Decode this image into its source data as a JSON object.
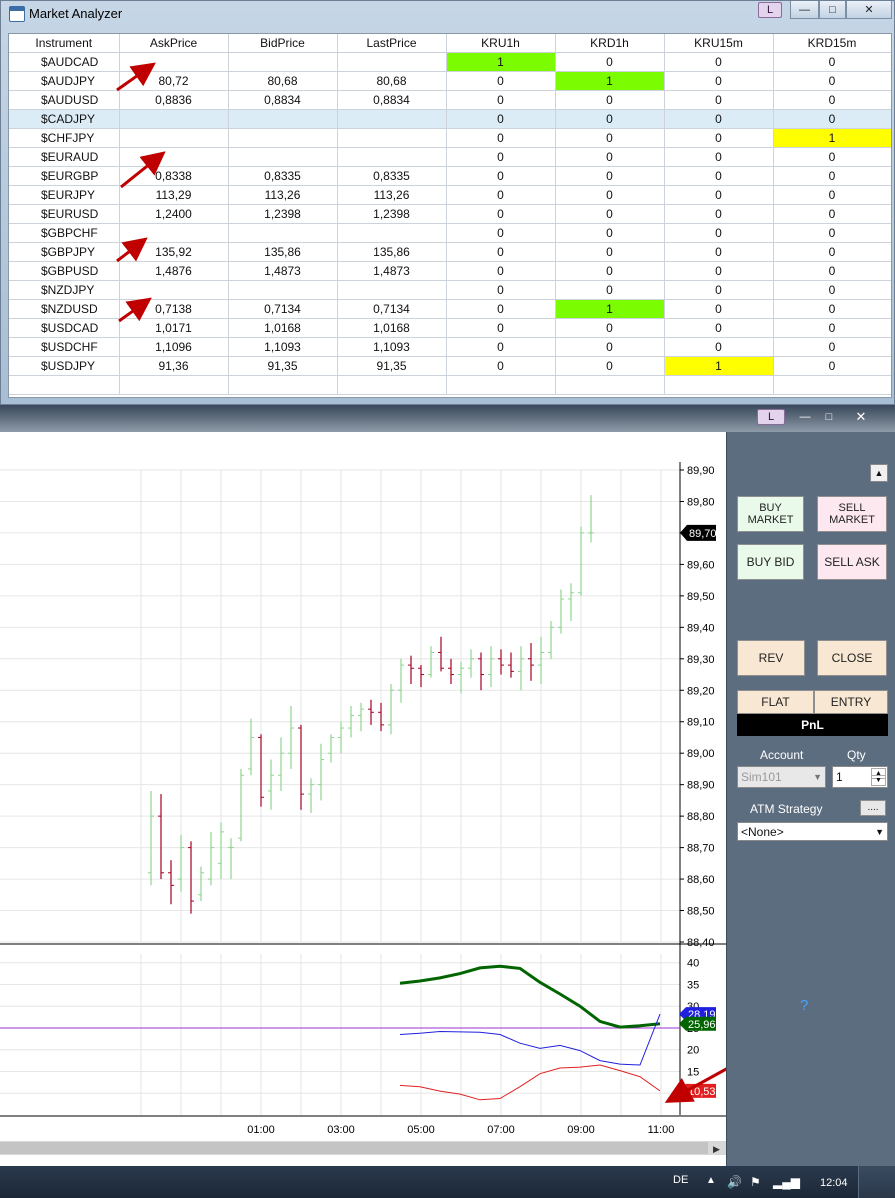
{
  "market_analyzer": {
    "title": "Market Analyzer",
    "l_button": "L",
    "columns": [
      "Instrument",
      "AskPrice",
      "BidPrice",
      "LastPrice",
      "KRU1h",
      "KRD1h",
      "KRU15m",
      "KRD15m"
    ],
    "rows": [
      {
        "instrument": "$AUDCAD",
        "ask": "",
        "bid": "",
        "last": "",
        "kru1h": "1",
        "krd1h": "0",
        "kru15m": "0",
        "krd15m": "0",
        "hl": [
          "kru1h"
        ],
        "hl_color": "green"
      },
      {
        "instrument": "$AUDJPY",
        "ask": "80,72",
        "bid": "80,68",
        "last": "80,68",
        "kru1h": "0",
        "krd1h": "1",
        "kru15m": "0",
        "krd15m": "0",
        "hl": [
          "krd1h"
        ],
        "hl_color": "green"
      },
      {
        "instrument": "$AUDUSD",
        "ask": "0,8836",
        "bid": "0,8834",
        "last": "0,8834",
        "kru1h": "0",
        "krd1h": "0",
        "kru15m": "0",
        "krd15m": "0",
        "hl": []
      },
      {
        "instrument": "$CADJPY",
        "ask": "",
        "bid": "",
        "last": "",
        "kru1h": "0",
        "krd1h": "0",
        "kru15m": "0",
        "krd15m": "0",
        "hl": [],
        "selected": true
      },
      {
        "instrument": "$CHFJPY",
        "ask": "",
        "bid": "",
        "last": "",
        "kru1h": "0",
        "krd1h": "0",
        "kru15m": "0",
        "krd15m": "1",
        "hl": [
          "krd15m"
        ],
        "hl_color": "yellow"
      },
      {
        "instrument": "$EURAUD",
        "ask": "",
        "bid": "",
        "last": "",
        "kru1h": "0",
        "krd1h": "0",
        "kru15m": "0",
        "krd15m": "0",
        "hl": []
      },
      {
        "instrument": "$EURGBP",
        "ask": "0,8338",
        "bid": "0,8335",
        "last": "0,8335",
        "kru1h": "0",
        "krd1h": "0",
        "kru15m": "0",
        "krd15m": "0",
        "hl": []
      },
      {
        "instrument": "$EURJPY",
        "ask": "113,29",
        "bid": "113,26",
        "last": "113,26",
        "kru1h": "0",
        "krd1h": "0",
        "kru15m": "0",
        "krd15m": "0",
        "hl": []
      },
      {
        "instrument": "$EURUSD",
        "ask": "1,2400",
        "bid": "1,2398",
        "last": "1,2398",
        "kru1h": "0",
        "krd1h": "0",
        "kru15m": "0",
        "krd15m": "0",
        "hl": []
      },
      {
        "instrument": "$GBPCHF",
        "ask": "",
        "bid": "",
        "last": "",
        "kru1h": "0",
        "krd1h": "0",
        "kru15m": "0",
        "krd15m": "0",
        "hl": []
      },
      {
        "instrument": "$GBPJPY",
        "ask": "135,92",
        "bid": "135,86",
        "last": "135,86",
        "kru1h": "0",
        "krd1h": "0",
        "kru15m": "0",
        "krd15m": "0",
        "hl": []
      },
      {
        "instrument": "$GBPUSD",
        "ask": "1,4876",
        "bid": "1,4873",
        "last": "1,4873",
        "kru1h": "0",
        "krd1h": "0",
        "kru15m": "0",
        "krd15m": "0",
        "hl": []
      },
      {
        "instrument": "$NZDJPY",
        "ask": "",
        "bid": "",
        "last": "",
        "kru1h": "0",
        "krd1h": "0",
        "kru15m": "0",
        "krd15m": "0",
        "hl": []
      },
      {
        "instrument": "$NZDUSD",
        "ask": "0,7138",
        "bid": "0,7134",
        "last": "0,7134",
        "kru1h": "0",
        "krd1h": "1",
        "kru15m": "0",
        "krd15m": "0",
        "hl": [
          "krd1h"
        ],
        "hl_color": "green"
      },
      {
        "instrument": "$USDCAD",
        "ask": "1,0171",
        "bid": "1,0168",
        "last": "1,0168",
        "kru1h": "0",
        "krd1h": "0",
        "kru15m": "0",
        "krd15m": "0",
        "hl": []
      },
      {
        "instrument": "$USDCHF",
        "ask": "1,1096",
        "bid": "1,1093",
        "last": "1,1093",
        "kru1h": "0",
        "krd1h": "0",
        "kru15m": "0",
        "krd15m": "0",
        "hl": []
      },
      {
        "instrument": "$USDJPY",
        "ask": "91,36",
        "bid": "91,35",
        "last": "91,35",
        "kru1h": "0",
        "krd1h": "0",
        "kru15m": "1",
        "krd15m": "0",
        "hl": [
          "kru15m"
        ],
        "hl_color": "yellow"
      }
    ]
  },
  "chart_window": {
    "l_button": "L",
    "price_axis": [
      "89,90",
      "89,80",
      "89,70",
      "89,60",
      "89,50",
      "89,40",
      "89,30",
      "89,20",
      "89,10",
      "89,00",
      "88,90",
      "88,80",
      "88,70",
      "88,60",
      "88,50",
      "88,40"
    ],
    "last_price": "89,70",
    "indicator_axis": [
      "40",
      "35",
      "30",
      "25",
      "20",
      "15",
      "10"
    ],
    "time_axis": [
      "01:00",
      "03:00",
      "05:00",
      "07:00",
      "09:00",
      "11:00"
    ],
    "indicator_labels": {
      "blue": "28,19",
      "green": "25,96",
      "red": "10,53"
    },
    "question_mark": "?",
    "colors": {
      "up_bar": "#8fd48f",
      "down_bar": "#a50021",
      "green_line": "#006400",
      "blue_line": "#1f1fe0",
      "red_line": "#e02020",
      "purple_line": "#9b30d0"
    }
  },
  "chart_data": [
    {
      "type": "ohlc",
      "ylim": [
        88.4,
        89.9
      ],
      "x": [
        "00:00",
        "00:15",
        "00:30",
        "00:45",
        "01:00",
        "01:15",
        "01:30",
        "01:45",
        "02:00",
        "02:15",
        "02:30",
        "02:45",
        "03:00",
        "03:15",
        "03:30",
        "03:45",
        "04:00",
        "04:15",
        "04:30",
        "04:45",
        "05:00",
        "05:15",
        "05:30",
        "05:45",
        "06:00",
        "06:15",
        "06:30",
        "06:45",
        "07:00",
        "07:15",
        "07:30",
        "07:45",
        "08:00",
        "08:15",
        "08:30",
        "08:45",
        "09:00",
        "09:15",
        "09:30",
        "09:45",
        "10:00",
        "10:15",
        "10:30",
        "10:45",
        "11:00"
      ],
      "bars": [
        [
          88.62,
          88.88,
          88.58,
          88.8
        ],
        [
          88.8,
          88.87,
          88.6,
          88.62
        ],
        [
          88.62,
          88.66,
          88.52,
          88.58
        ],
        [
          88.6,
          88.74,
          88.56,
          88.7
        ],
        [
          88.7,
          88.72,
          88.49,
          88.53
        ],
        [
          88.55,
          88.64,
          88.53,
          88.62
        ],
        [
          88.6,
          88.75,
          88.58,
          88.7
        ],
        [
          88.65,
          88.78,
          88.6,
          88.75
        ],
        [
          88.7,
          88.73,
          88.6,
          88.7
        ],
        [
          88.73,
          88.95,
          88.72,
          88.93
        ],
        [
          88.95,
          89.11,
          88.93,
          89.05
        ],
        [
          89.05,
          89.06,
          88.83,
          88.86
        ],
        [
          88.88,
          88.98,
          88.82,
          88.93
        ],
        [
          88.93,
          89.05,
          88.88,
          89.0
        ],
        [
          89.0,
          89.15,
          88.95,
          89.08
        ],
        [
          89.08,
          89.09,
          88.82,
          88.87
        ],
        [
          88.87,
          88.92,
          88.81,
          88.9
        ],
        [
          88.9,
          89.03,
          88.85,
          88.98
        ],
        [
          89.0,
          89.06,
          88.97,
          89.05
        ],
        [
          89.05,
          89.1,
          89.0,
          89.08
        ],
        [
          89.08,
          89.15,
          89.05,
          89.12
        ],
        [
          89.12,
          89.16,
          89.07,
          89.14
        ],
        [
          89.14,
          89.17,
          89.09,
          89.13
        ],
        [
          89.13,
          89.16,
          89.07,
          89.09
        ],
        [
          89.09,
          89.22,
          89.06,
          89.2
        ],
        [
          89.2,
          89.3,
          89.16,
          89.28
        ],
        [
          89.28,
          89.31,
          89.22,
          89.27
        ],
        [
          89.27,
          89.28,
          89.21,
          89.25
        ],
        [
          89.25,
          89.34,
          89.24,
          89.32
        ],
        [
          89.32,
          89.37,
          89.26,
          89.27
        ],
        [
          89.27,
          89.3,
          89.22,
          89.25
        ],
        [
          89.25,
          89.29,
          89.19,
          89.27
        ],
        [
          89.27,
          89.33,
          89.24,
          89.3
        ],
        [
          89.3,
          89.32,
          89.2,
          89.25
        ],
        [
          89.25,
          89.34,
          89.21,
          89.3
        ],
        [
          89.3,
          89.33,
          89.25,
          89.28
        ],
        [
          89.28,
          89.32,
          89.24,
          89.26
        ],
        [
          89.26,
          89.34,
          89.2,
          89.3
        ],
        [
          89.3,
          89.35,
          89.23,
          89.28
        ],
        [
          89.28,
          89.37,
          89.22,
          89.32
        ],
        [
          89.32,
          89.42,
          89.3,
          89.4
        ],
        [
          89.4,
          89.52,
          89.38,
          89.49
        ],
        [
          89.49,
          89.54,
          89.42,
          89.51
        ],
        [
          89.51,
          89.72,
          89.5,
          89.7
        ],
        [
          89.7,
          89.82,
          89.67,
          89.7
        ]
      ]
    },
    {
      "type": "line",
      "ylim": [
        5,
        42
      ],
      "x": [
        "04:30",
        "05:00",
        "05:30",
        "06:00",
        "06:30",
        "07:00",
        "07:30",
        "08:00",
        "08:30",
        "09:00",
        "09:30",
        "10:00",
        "10:30",
        "11:00"
      ],
      "series": [
        {
          "color": "#006400",
          "values": [
            35.3,
            35.8,
            36.5,
            37.5,
            38.8,
            39.2,
            38.7,
            35.5,
            32.8,
            30.0,
            26.5,
            25.2,
            25.5,
            25.96
          ]
        },
        {
          "color": "#1f1fe0",
          "values": [
            23.5,
            23.8,
            24.2,
            24.1,
            24.0,
            23.5,
            21.5,
            20.3,
            21.0,
            19.8,
            17.5,
            16.7,
            16.5,
            28.19
          ]
        },
        {
          "color": "#e02020",
          "values": [
            11.8,
            11.5,
            10.5,
            9.8,
            8.5,
            8.8,
            11.5,
            14.5,
            15.8,
            16.0,
            16.5,
            15.2,
            13.8,
            10.53
          ]
        }
      ],
      "hline": 25
    }
  ],
  "side_panel": {
    "buy_market": "BUY MARKET",
    "sell_market": "SELL MARKET",
    "buy_bid": "BUY BID",
    "sell_ask": "SELL ASK",
    "rev": "REV",
    "close": "CLOSE",
    "flat": "FLAT",
    "entry": "ENTRY",
    "pnl": "PnL",
    "account_label": "Account",
    "qty_label": "Qty",
    "account_value": "Sim101",
    "qty_value": "1",
    "atm_label": "ATM Strategy",
    "atm_value": "<None>",
    "atm_button": "...."
  },
  "taskbar": {
    "lang": "DE",
    "clock": "12:04"
  }
}
